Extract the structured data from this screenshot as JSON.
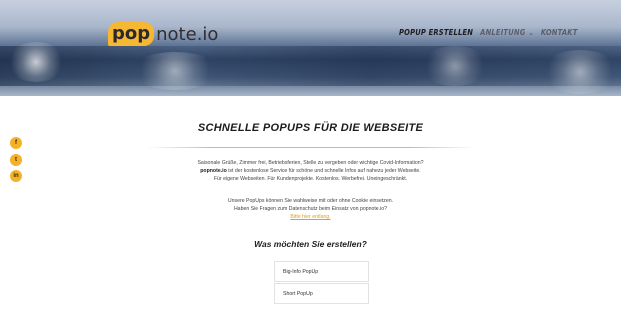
{
  "logo": {
    "pop": "pop",
    "rest": "note.io"
  },
  "nav": {
    "active": "POPUP ERSTELLEN",
    "anleitung": "ANLEITUNG",
    "anleitung_caret": "⌄",
    "kontakt": "KONTAKT"
  },
  "social": {
    "facebook": "f",
    "twitter": "t",
    "linkedin": "in"
  },
  "main": {
    "heading": "SCHNELLE POPUPS FÜR DIE WEBSEITE",
    "p1_line1": "Saisonale Grüße, Zimmer frei, Betriebsferien, Stelle zu vergeben oder wichtige Covid-Information?",
    "p1_line2_bold": "popnote.io",
    "p1_line2_rest": " ist der kostenlose Service für schöne und schnelle Infos auf nahezu jeder Webseite.",
    "p1_line3": "Für eigene Webseiten. Für Kundenprojekte. Kostenlos. Werbefrei. Uneingeschränkt.",
    "p2_line1": "Unsere PopUps können Sie wahlweise mit oder ohne Cookie einsetzen.",
    "p2_line2": "Haben Sie Fragen zum Datenschutz beim Einsatz von popnote.io?",
    "p2_link": "Bitte hier entlang.",
    "question": "Was möchten Sie erstellen?",
    "options": [
      "Big-Info PopUp",
      "Short PopUp"
    ]
  },
  "colors": {
    "accent": "#f6b733",
    "text": "#333333"
  }
}
